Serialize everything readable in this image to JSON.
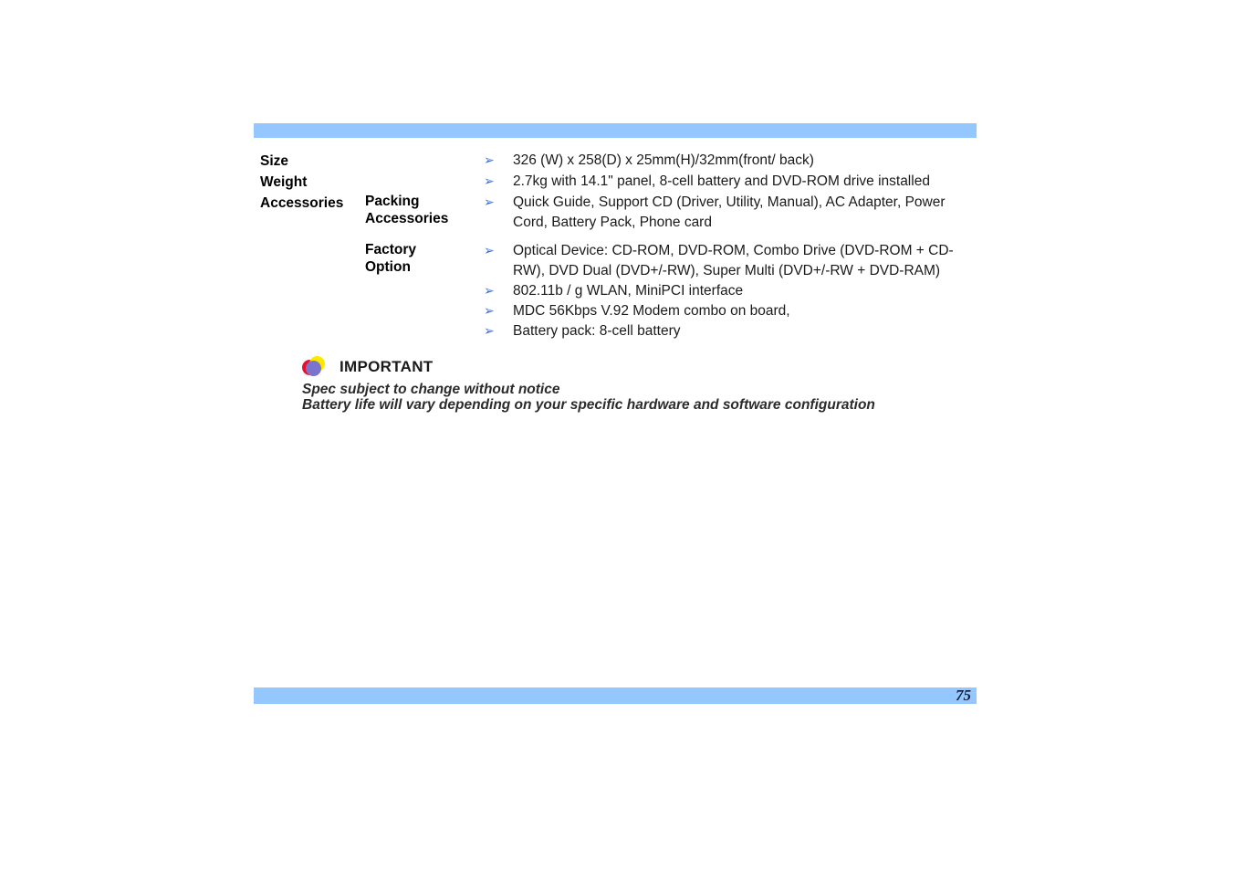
{
  "document": {
    "page_number": "75"
  },
  "spec": {
    "rows": [
      {
        "label": "Size",
        "sublabel": "",
        "bullets": [
          "326 (W) x 258(D) x 25mm(H)/32mm(front/ back)"
        ]
      },
      {
        "label": "Weight",
        "sublabel": "",
        "bullets": [
          "2.7kg with 14.1\" panel, 8-cell battery and DVD-ROM drive installed"
        ]
      },
      {
        "label": "Accessories",
        "sublabel": "Packing Accessories",
        "sublabel_line1": "Packing",
        "sublabel_line2": "Accessories",
        "bullets": [
          "Quick Guide, Support CD (Driver, Utility, Manual), AC Adapter, Power Cord, Battery Pack, Phone card"
        ]
      },
      {
        "label": "",
        "sublabel": "Factory Option",
        "sublabel_line1": "Factory",
        "sublabel_line2": "Option",
        "bullets": [
          "Optical Device: CD-ROM, DVD-ROM, Combo Drive (DVD-ROM + CD-RW), DVD Dual (DVD+/-RW), Super Multi (DVD+/-RW + DVD-RAM)",
          "802.11b / g WLAN, MiniPCI interface",
          "MDC 56Kbps V.92 Modem combo on board,",
          "Battery pack: 8-cell battery"
        ]
      }
    ],
    "bullet_glyph": "➢"
  },
  "note": {
    "title": "IMPORTANT",
    "lines": [
      "Spec subject to change without notice",
      "Battery life will vary depending on your specific hardware and software configuration"
    ]
  },
  "colors": {
    "bar_blue": "#93c7fd",
    "bullet_blue": "#3a6fd8",
    "icon_red": "#e8112d",
    "icon_yellow": "#ffe800",
    "icon_purple": "#7b74cd"
  }
}
